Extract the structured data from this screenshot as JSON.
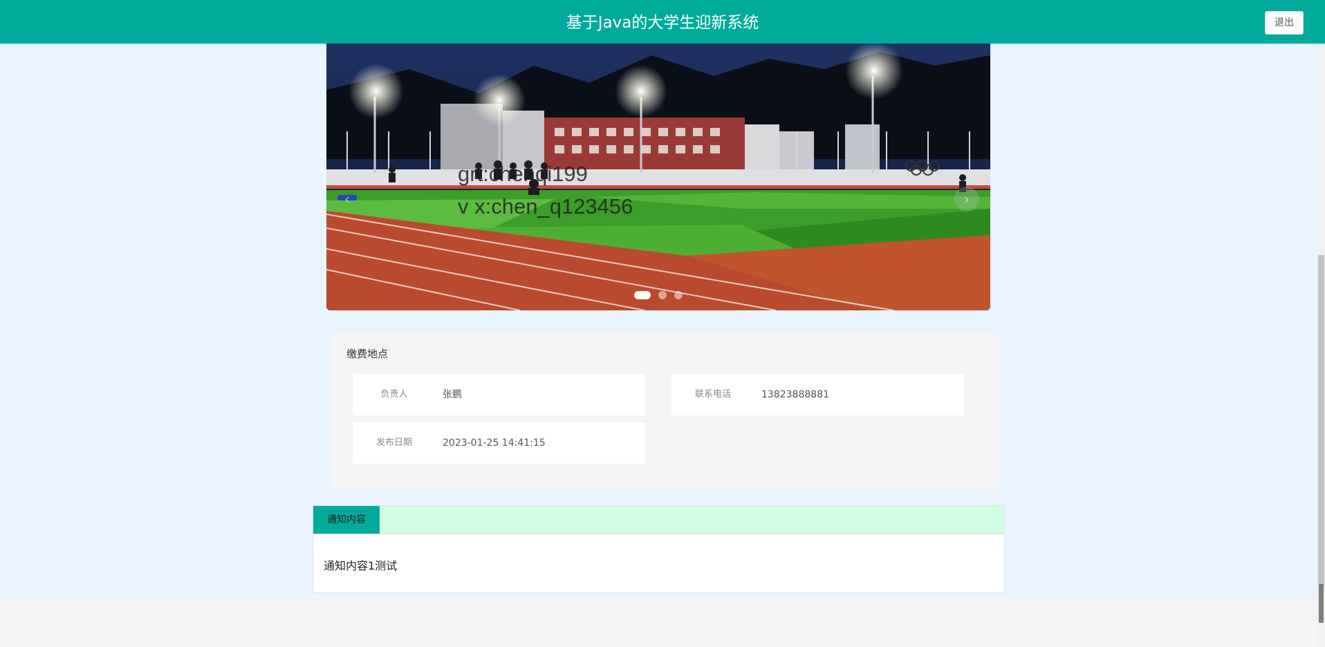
{
  "header": {
    "title": "基于Java的大学生迎新系统",
    "logout_label": "退出"
  },
  "carousel": {
    "watermark_lines": [
      "grt:chenqi199",
      "v x:chen_q123456"
    ],
    "slide_count": 3,
    "active_index": 0,
    "prev_arrow": "‹",
    "next_arrow": "›"
  },
  "info": {
    "title": "缴费地点",
    "fields": [
      {
        "label": "负责人",
        "value": "张鹏"
      },
      {
        "label": "联系电话",
        "value": "13823888881"
      },
      {
        "label": "发布日期",
        "value": "2023-01-25 14:41:15"
      }
    ]
  },
  "notice": {
    "tab_label": "通知内容",
    "content": "通知内容1测试"
  },
  "colors": {
    "primary": "#00ab9c",
    "tab_strip": "#d3fde3",
    "page_bg": "#eaf4ff"
  }
}
